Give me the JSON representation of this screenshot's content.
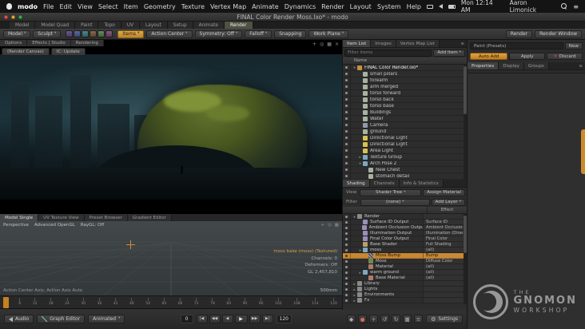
{
  "icons": {
    "caret": "▾",
    "caret_right": "▸",
    "close": "×",
    "plus": "+",
    "gear": "⚙",
    "circle": "●",
    "diamond": "◆",
    "target": "◎",
    "grid": "▦",
    "bars": "≡",
    "undo": "↺",
    "redo": "↻",
    "to_start": "|◀",
    "fast_back": "◀◀",
    "step_back": "◀",
    "play": "▶",
    "fast_fwd": "▶▶",
    "to_end": "▶|"
  },
  "menubar": {
    "app": "modo",
    "menus": [
      "File",
      "Edit",
      "View",
      "Select",
      "Item",
      "Geometry",
      "Texture",
      "Vertex Map",
      "Animate",
      "Dynamics",
      "Render",
      "Layout",
      "System",
      "Help"
    ],
    "clock": "Mon 12:14 AM",
    "user": "Aaron Limonick"
  },
  "titlebar": {
    "title": "FINAL Color Render Moss.lxo* - modo"
  },
  "layout_tabs": [
    {
      "label": "Model"
    },
    {
      "label": "Model Quad"
    },
    {
      "label": "Paint"
    },
    {
      "label": "Topo"
    },
    {
      "label": "UV"
    },
    {
      "label": "Layout"
    },
    {
      "label": "Setup"
    },
    {
      "label": "Animate"
    },
    {
      "label": "Render",
      "active": true
    }
  ],
  "toolbar": {
    "model": "Model",
    "sculpt": "Sculpt",
    "items": "Items",
    "action_center": "Action Center",
    "symmetry": "Symmetry: Off",
    "falloff": "Falloff",
    "snapping": "Snapping",
    "work_plane": "Work Plane",
    "render": "Render",
    "render_window": "Render Window"
  },
  "canvas_bar": {
    "tabs": [
      {
        "label": "Options"
      },
      {
        "label": "Effects | Studio"
      },
      {
        "label": "Rendering"
      }
    ],
    "buttons": [
      {
        "label": "(Render Canvas)"
      },
      {
        "label": "IC: Update"
      }
    ]
  },
  "model_view": {
    "tabs": [
      {
        "label": "Model Single",
        "active": true
      },
      {
        "label": "UV Texture View"
      },
      {
        "label": "Preset Browser"
      },
      {
        "label": "Gradient Editor"
      }
    ],
    "camera": "Perspective",
    "shading_mode": "Advanced OpenGL",
    "raygl": "RayGL: Off",
    "status": "Action Center Axis: Action Axis Auto",
    "stats": [
      {
        "text": "moss bake (moss) (Textured)",
        "highlight": true
      },
      {
        "text": "Channels: 0"
      },
      {
        "text": "Deformers: Off"
      },
      {
        "text": "GL 2,457,810"
      }
    ],
    "scale": "500mm"
  },
  "timeline": {
    "ticks": [
      0,
      6,
      12,
      18,
      24,
      30,
      36,
      42,
      48,
      54,
      60,
      66,
      72,
      78,
      84,
      90,
      96,
      102,
      108,
      114,
      120
    ]
  },
  "bottom_bar": {
    "audio": "Audio",
    "graph_editor": "Graph Editor",
    "animated": "Animated",
    "current_frame": "0",
    "end_frame": "120",
    "settings": "Settings"
  },
  "item_list": {
    "tabs": [
      {
        "label": "Item List",
        "active": true
      },
      {
        "label": "Images"
      },
      {
        "label": "Vertex Map List"
      }
    ],
    "filter_placeholder": "Filter items",
    "add_item": "Add Item",
    "name_column": "Name",
    "rows": [
      {
        "label": "FINAL Color Render.lxo*",
        "indent": 0,
        "arrow": "▾",
        "kind": "sceneitem"
      },
      {
        "label": "small pillars",
        "indent": 1,
        "kind": "mesh"
      },
      {
        "label": "forearm",
        "indent": 1,
        "kind": "mesh"
      },
      {
        "label": "arm merged",
        "indent": 1,
        "kind": "mesh"
      },
      {
        "label": "torso forward",
        "indent": 1,
        "kind": "mesh"
      },
      {
        "label": "torso back",
        "indent": 1,
        "kind": "mesh"
      },
      {
        "label": "torso base",
        "indent": 1,
        "kind": "mesh"
      },
      {
        "label": "Buildings",
        "indent": 1,
        "kind": "mesh"
      },
      {
        "label": "Water",
        "indent": 1,
        "kind": "mesh"
      },
      {
        "label": "Camera",
        "indent": 1,
        "kind": "camera"
      },
      {
        "label": "ground",
        "indent": 1,
        "kind": "mesh"
      },
      {
        "label": "Directional Light",
        "indent": 1,
        "kind": "light"
      },
      {
        "label": "Directional Light",
        "indent": 1,
        "kind": "light"
      },
      {
        "label": "Area Light",
        "indent": 1,
        "kind": "light"
      },
      {
        "label": "Texture Group",
        "indent": 1,
        "arrow": "▸",
        "kind": "group"
      },
      {
        "label": "Arch Pose 2",
        "indent": 1,
        "arrow": "▾",
        "kind": "group"
      },
      {
        "label": "New Chest",
        "indent": 2,
        "kind": "mesh"
      },
      {
        "label": "stomach detail",
        "indent": 2,
        "kind": "mesh"
      }
    ]
  },
  "shading": {
    "tabs": [
      {
        "label": "Shading",
        "active": true
      },
      {
        "label": "Channels"
      },
      {
        "label": "Info & Statistics"
      }
    ],
    "view_label": "View",
    "view_value": "Shader Tree",
    "assign_material": "Assign Material",
    "filter_label": "Filter",
    "filter_value": "(none)",
    "add_layer": "Add Layer",
    "effect_column": "Effect",
    "rows": [
      {
        "name": "Render",
        "effect": "",
        "indent": 0,
        "arrow": "▾",
        "kind": "render"
      },
      {
        "name": "Surface ID Output",
        "effect": "Surface ID",
        "indent": 1,
        "kind": "output"
      },
      {
        "name": "Ambient Occlusion Output",
        "effect": "Ambient Occlusion",
        "indent": 1,
        "kind": "output"
      },
      {
        "name": "Illumination Output",
        "effect": "Illumination (Direct)",
        "indent": 1,
        "kind": "output"
      },
      {
        "name": "Final Color Output",
        "effect": "Final Color",
        "indent": 1,
        "kind": "output"
      },
      {
        "name": "Base Shader",
        "effect": "Full Shading",
        "indent": 1,
        "kind": "shader"
      },
      {
        "name": "moss",
        "effect": "(all)",
        "indent": 1,
        "arrow": "▾",
        "kind": "group"
      },
      {
        "name": "Moss Bump",
        "effect": "Bump",
        "indent": 2,
        "kind": "texture",
        "selected": true
      },
      {
        "name": "Moss",
        "effect": "Diffuse Color",
        "indent": 2,
        "kind": "image"
      },
      {
        "name": "Material",
        "effect": "(all)",
        "indent": 2,
        "kind": "material"
      },
      {
        "name": "warm ground",
        "effect": "(all)",
        "indent": 1,
        "arrow": "▸",
        "kind": "group"
      },
      {
        "name": "Base Material",
        "effect": "(all)",
        "indent": 2,
        "kind": "material"
      },
      {
        "name": "Library",
        "effect": "",
        "indent": 0,
        "arrow": "▸",
        "kind": "folder"
      },
      {
        "name": "Lights",
        "effect": "",
        "indent": 0,
        "arrow": "▸",
        "kind": "folder"
      },
      {
        "name": "Environments",
        "effect": "",
        "indent": 0,
        "arrow": "▸",
        "kind": "folder"
      },
      {
        "name": "Fx",
        "effect": "",
        "indent": 0,
        "arrow": "▸",
        "kind": "folder"
      }
    ]
  },
  "right_panel": {
    "header": "Paint (Presets)",
    "new_button": "New",
    "auto_add": "Auto Add",
    "apply": "Apply",
    "discard": "Discard",
    "tabs": [
      {
        "label": "Properties",
        "active": true
      },
      {
        "label": "Display"
      },
      {
        "label": "Groups"
      }
    ]
  },
  "watermark": {
    "the": "THE",
    "gnomon": "GNOMON",
    "workshop": "WORKSHOP"
  }
}
